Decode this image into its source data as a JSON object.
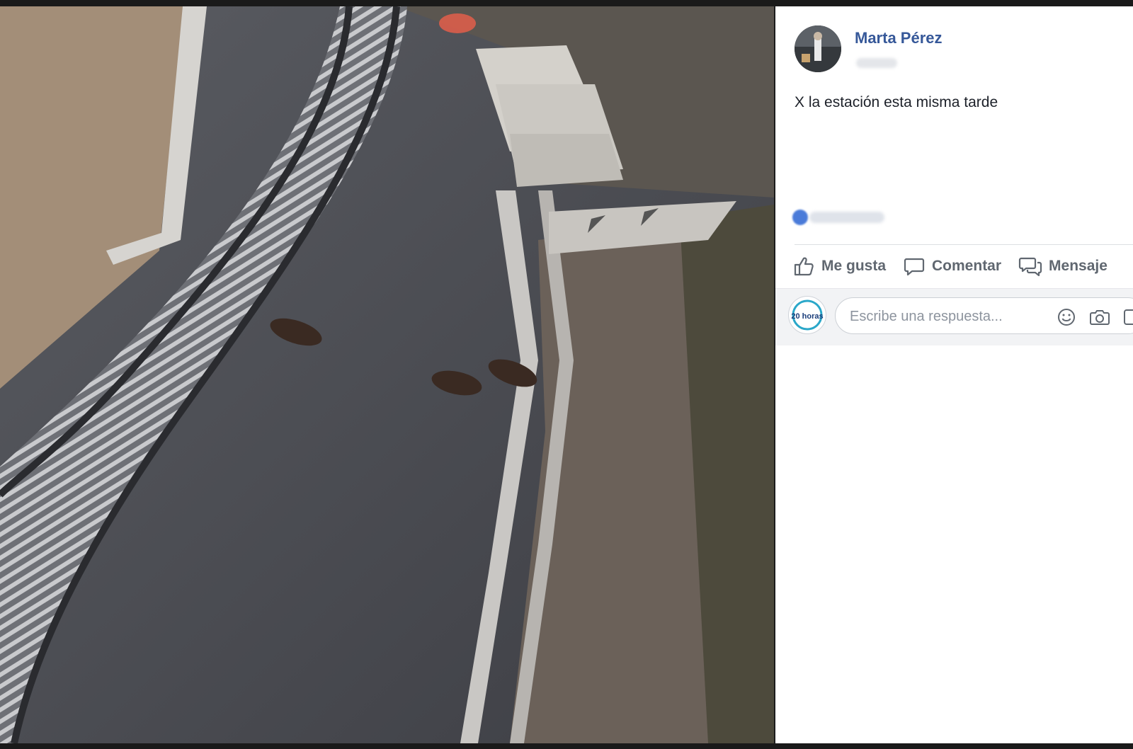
{
  "post": {
    "author": "Marta Pérez",
    "text": "X la estación esta misma tarde"
  },
  "actions": {
    "like": "Me gusta",
    "comment": "Comentar",
    "message": "Mensaje"
  },
  "reply": {
    "placeholder": "Escribe una respuesta...",
    "avatar_logo": "20 horas"
  },
  "icons": [
    "like-icon",
    "comment-icon",
    "message-icon",
    "emoji-icon",
    "camera-icon",
    "gif-icon"
  ],
  "colors": {
    "author_link": "#365899",
    "action_text": "#606770",
    "panel_bg": "#ffffff",
    "comment_bar_bg": "#f2f3f5"
  }
}
